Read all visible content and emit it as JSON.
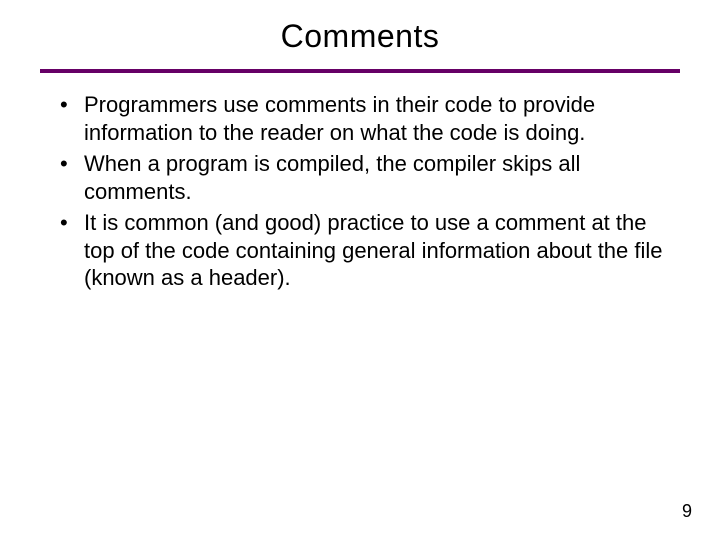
{
  "title": "Comments",
  "bullets": [
    "Programmers use comments in their code to provide information to the reader on what the code is doing.",
    "When a program is compiled, the compiler skips all comments.",
    "It is common (and good) practice to use a comment at the top of the code containing general information about the file (known as a header)."
  ],
  "page_number": "9"
}
